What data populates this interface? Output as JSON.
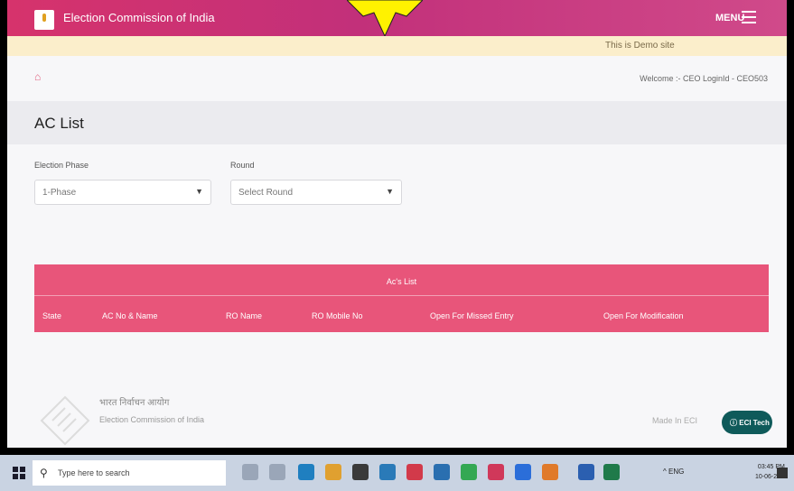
{
  "header": {
    "app_title": "Election Commission of India",
    "menu_label": "MENU"
  },
  "demo_notice": "This is Demo site",
  "welcome": "Welcome :- CEO LoginId - CEO503",
  "page_title": "AC List",
  "filters": {
    "election_phase_label": "Election Phase",
    "election_phase_value": "1-Phase",
    "round_label": "Round",
    "round_value": "Select Round"
  },
  "table": {
    "title": "Ac's List",
    "columns": [
      "State",
      "AC No & Name",
      "RO Name",
      "RO Mobile No",
      "Open For Missed Entry",
      "Open For Modification"
    ]
  },
  "footer": {
    "hindi_name": "भारत निर्वाचन आयोग",
    "english_name": "Election Commission of India",
    "made_in": "Made In ECI",
    "badge": "ECI Tech"
  },
  "taskbar": {
    "search_placeholder": "Type here to search",
    "tray_text": "^ ENG",
    "time": "03:45 PM",
    "date": "10-06-2021"
  },
  "colors": {
    "header": "#d6336c",
    "table": "#e8557a",
    "badge": "#0f5a5a",
    "demo_strip": "#fbeecb"
  },
  "icons": [
    "eci-logo-icon",
    "starburst-icon",
    "menu-icon",
    "home-icon",
    "chevron-down-icon",
    "eci-emblem-icon",
    "windows-icon",
    "search-icon"
  ]
}
